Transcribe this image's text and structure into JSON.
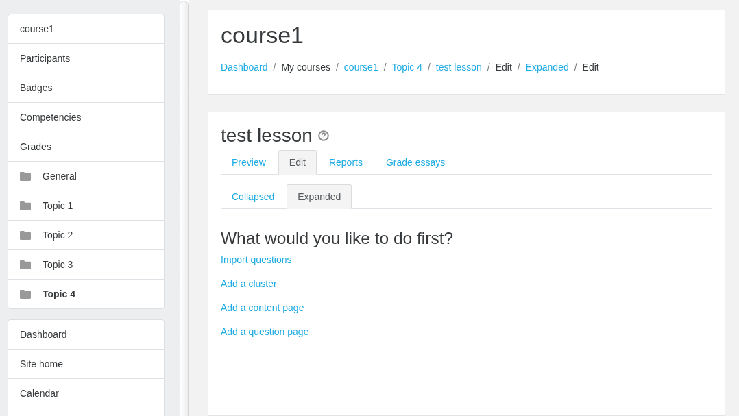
{
  "sidebar": {
    "course_nav": [
      {
        "label": "course1",
        "kind": "link",
        "selected": false
      },
      {
        "label": "Participants",
        "kind": "link",
        "selected": false
      },
      {
        "label": "Badges",
        "kind": "link",
        "selected": false
      },
      {
        "label": "Competencies",
        "kind": "link",
        "selected": false
      },
      {
        "label": "Grades",
        "kind": "link",
        "selected": false
      },
      {
        "label": "General",
        "kind": "section",
        "selected": false
      },
      {
        "label": "Topic 1",
        "kind": "section",
        "selected": false
      },
      {
        "label": "Topic 2",
        "kind": "section",
        "selected": false
      },
      {
        "label": "Topic 3",
        "kind": "section",
        "selected": false
      },
      {
        "label": "Topic 4",
        "kind": "section",
        "selected": true
      }
    ],
    "site_nav": [
      {
        "label": "Dashboard",
        "kind": "link",
        "selected": false
      },
      {
        "label": "Site home",
        "kind": "link",
        "selected": false
      },
      {
        "label": "Calendar",
        "kind": "link",
        "selected": false
      }
    ]
  },
  "header": {
    "title": "course1",
    "breadcrumb": [
      {
        "kind": "link",
        "label": "Dashboard"
      },
      {
        "kind": "separator",
        "label": "/"
      },
      {
        "kind": "text",
        "label": "My courses"
      },
      {
        "kind": "separator",
        "label": "/"
      },
      {
        "kind": "link",
        "label": "course1"
      },
      {
        "kind": "separator",
        "label": "/"
      },
      {
        "kind": "link",
        "label": "Topic 4"
      },
      {
        "kind": "separator",
        "label": "/"
      },
      {
        "kind": "link",
        "label": "test lesson"
      },
      {
        "kind": "separator",
        "label": "/"
      },
      {
        "kind": "text",
        "label": "Edit"
      },
      {
        "kind": "separator",
        "label": "/"
      },
      {
        "kind": "link",
        "label": "Expanded"
      },
      {
        "kind": "separator",
        "label": "/"
      },
      {
        "kind": "text",
        "label": "Edit"
      }
    ]
  },
  "activity": {
    "title": "test lesson",
    "tabs": [
      {
        "label": "Preview",
        "selected": false
      },
      {
        "label": "Edit",
        "selected": true
      },
      {
        "label": "Reports",
        "selected": false
      },
      {
        "label": "Grade essays",
        "selected": false
      }
    ],
    "subtabs": [
      {
        "label": "Collapsed",
        "selected": false
      },
      {
        "label": "Expanded",
        "selected": true
      }
    ],
    "heading": "What would you like to do first?",
    "actions": [
      "Import questions",
      "Add a cluster",
      "Add a content page",
      "Add a question page"
    ]
  }
}
